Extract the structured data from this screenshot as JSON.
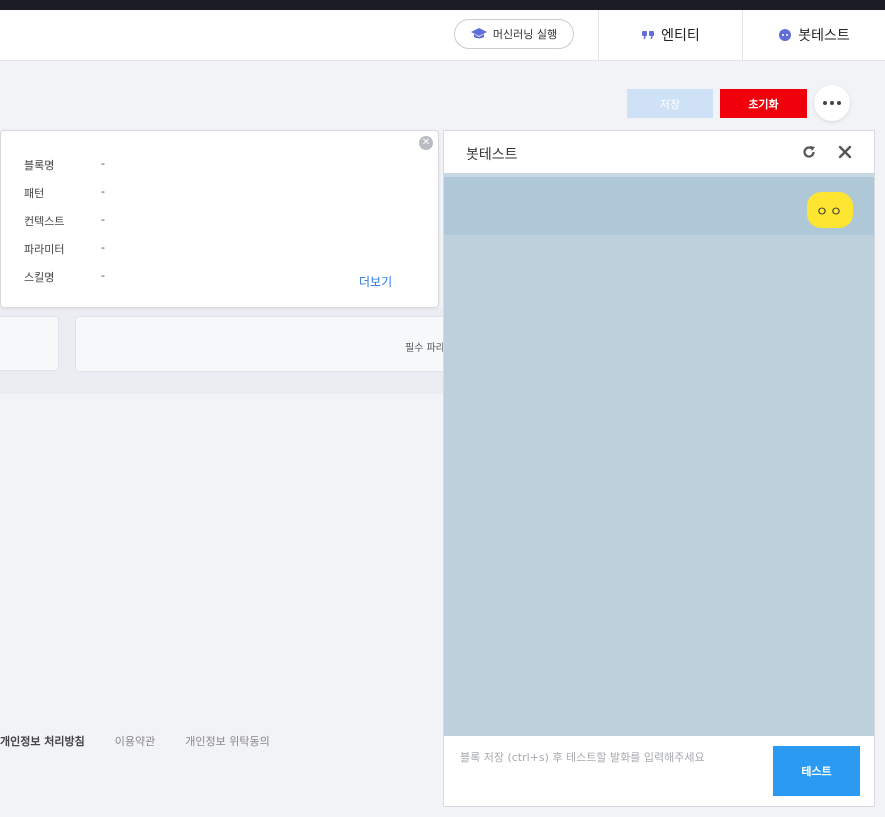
{
  "header": {
    "ml_button_label": "머신러닝 실행",
    "entity_label": "엔티티",
    "bottest_label": "봇테스트"
  },
  "toolbar": {
    "save_label": "저장",
    "reset_label": "초기화"
  },
  "info_popup": {
    "rows": [
      {
        "label": "블록명",
        "value": "-"
      },
      {
        "label": "패턴",
        "value": "-"
      },
      {
        "label": "컨텍스트",
        "value": "-"
      },
      {
        "label": "파라미터",
        "value": "-"
      },
      {
        "label": "스킬명",
        "value": "-"
      }
    ],
    "more_label": "더보기"
  },
  "parameters": {
    "required_label": "필수 파라미터"
  },
  "footer": {
    "privacy": "개인정보 처리방침",
    "terms": "이용약관",
    "consent": "개인정보 위탁동의"
  },
  "bot_test": {
    "title": "봇테스트",
    "bubble_text": "ㅇㅇ",
    "input_placeholder": "블록 저장 (ctrl+s) 후 테스트할 발화를 입력해주세요",
    "test_button": "테스트"
  },
  "colors": {
    "accent_red": "#f0000a",
    "accent_blue": "#2b9af3",
    "save_disabled": "#cfe1f7",
    "chat_bg": "#bdd1dc",
    "bubble_yellow": "#fde532"
  }
}
